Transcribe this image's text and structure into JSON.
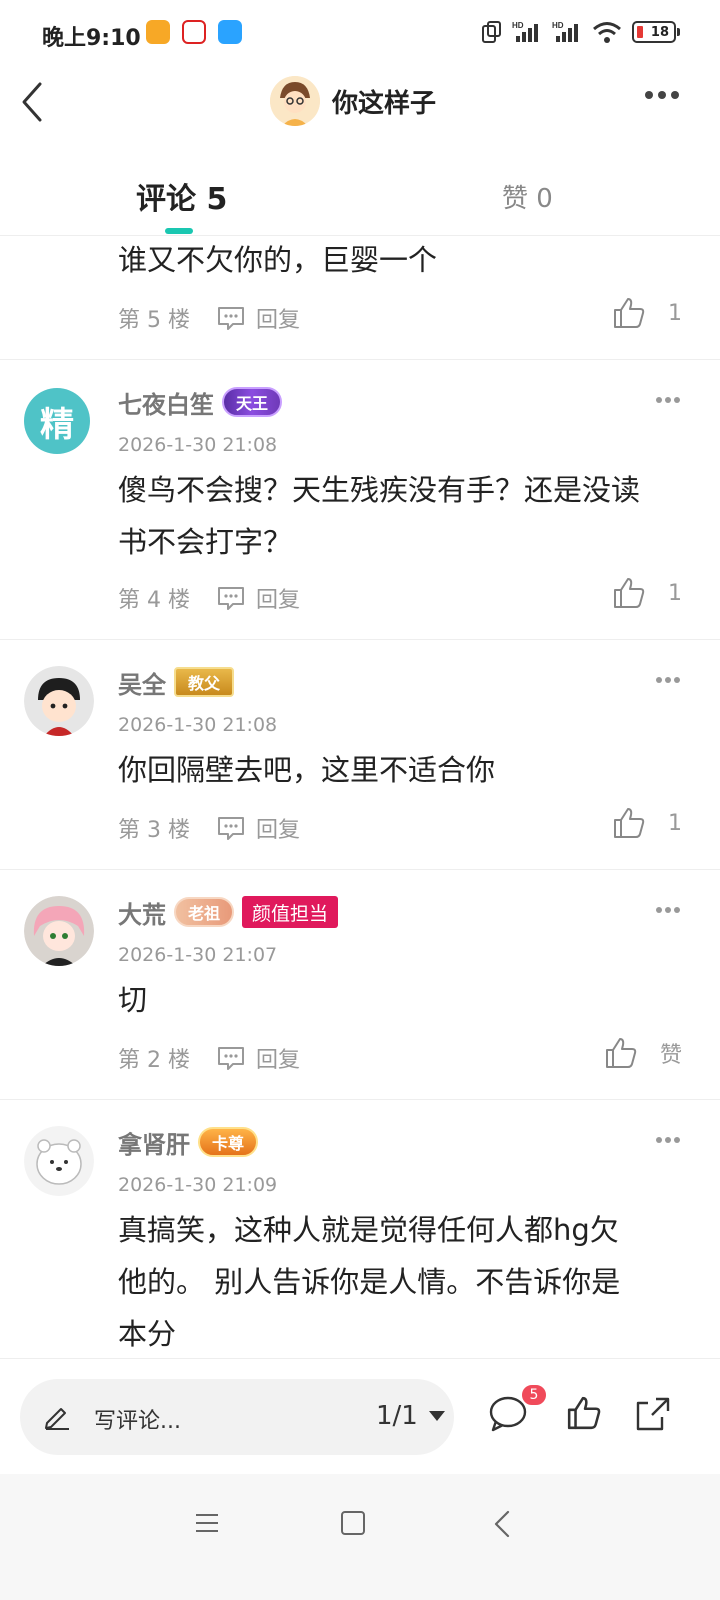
{
  "status_bar": {
    "time": "晚上9:10",
    "battery": "18",
    "signal_labels": [
      "HD",
      "HD"
    ]
  },
  "header": {
    "title": "你这样子"
  },
  "tabs": {
    "comments_label": "评论 5",
    "likes_label": "赞 0"
  },
  "comments": [
    {
      "text_lines": [
        "谁又不欠你的，巨婴一个"
      ],
      "floor": "第 5 楼",
      "reply": "回复",
      "likes": "1"
    },
    {
      "name": "七夜白笙",
      "avatar_text": "精",
      "badge": "天王",
      "time": "2026-1-30 21:08",
      "text_lines": [
        "傻鸟不会搜？天生残疾没有手？还是没读",
        "书不会打字？"
      ],
      "floor": "第 4 楼",
      "reply": "回复",
      "likes": "1"
    },
    {
      "name": "吴全",
      "badge": "教父",
      "time": "2026-1-30 21:08",
      "text_lines": [
        "你回隔壁去吧，这里不适合你"
      ],
      "floor": "第 3 楼",
      "reply": "回复",
      "likes": "1"
    },
    {
      "name": "大荒",
      "badge": "老祖",
      "tag": "颜值担当",
      "time": "2026-1-30 21:07",
      "text_lines": [
        "切"
      ],
      "floor": "第 2 楼",
      "reply": "回复",
      "likes": "赞"
    },
    {
      "name": "拿肾肝",
      "badge": "卡尊",
      "time": "2026-1-30 21:09",
      "text_lines": [
        "真搞笑，这种人就是觉得任何人都hg欠",
        "他的。 别人告诉你是人情。不告诉你是",
        "本分"
      ]
    }
  ],
  "bottom_bar": {
    "placeholder": "写评论...",
    "pager": "1/1",
    "comment_count": "5"
  },
  "colors": {
    "accent": "#1ac7b1",
    "tag_red": "#e0195c",
    "badge_red": "#f04a5a"
  }
}
